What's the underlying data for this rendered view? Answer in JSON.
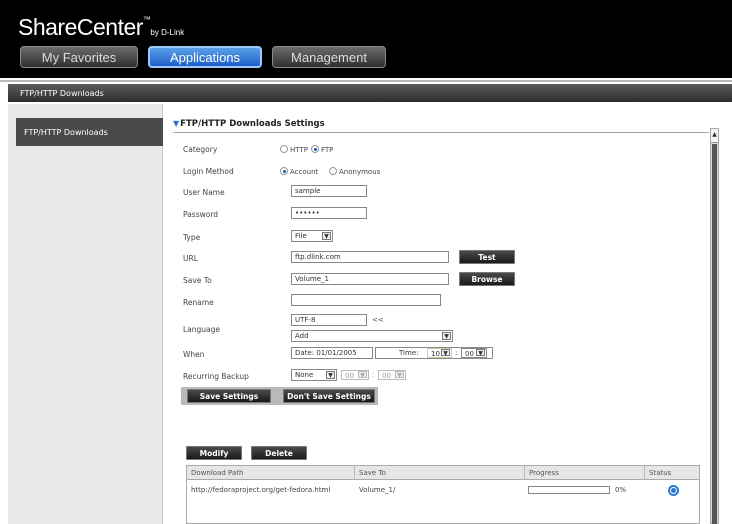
{
  "brand": {
    "name": "ShareCenter",
    "tm": "™",
    "by": "by D-Link"
  },
  "tabs": [
    {
      "label": "My Favorites"
    },
    {
      "label": "Applications"
    },
    {
      "label": "Management"
    }
  ],
  "titlebar": "FTP/HTTP Downloads",
  "sidebar": {
    "items": [
      {
        "label": "FTP/HTTP Downloads"
      }
    ]
  },
  "settings": {
    "title": "FTP/HTTP Downloads Settings",
    "category": {
      "label": "Category",
      "options": [
        "HTTP",
        "FTP"
      ],
      "selected": "FTP"
    },
    "login_method": {
      "label": "Login Method",
      "options": [
        "Account",
        "Anonymous"
      ],
      "selected": "Account"
    },
    "user_name": {
      "label": "User Name",
      "value": "sample"
    },
    "password": {
      "label": "Password",
      "value": "••••••"
    },
    "type": {
      "label": "Type",
      "value": "File"
    },
    "url": {
      "label": "URL",
      "value": "ftp.dlink.com",
      "test_label": "Test"
    },
    "save_to": {
      "label": "Save To",
      "value": "Volume_1",
      "browse_label": "Browse"
    },
    "rename": {
      "label": "Rename",
      "value": ""
    },
    "language": {
      "label": "Language",
      "value": "UTF-8",
      "arrows": "<<",
      "select_value": "Add"
    },
    "when": {
      "label": "When",
      "date_label": "Date:",
      "date_value": "01/01/2005",
      "time_label": "Time:",
      "hour": "10",
      "colon": ":",
      "minute": "00"
    },
    "recurring_backup": {
      "label": "Recurring Backup",
      "value": "None",
      "hour": "00",
      "colon": ":",
      "minute": "00"
    },
    "save_button": "Save Settings",
    "dont_save_button": "Don't Save Settings"
  },
  "actions": {
    "modify": "Modify",
    "delete": "Delete"
  },
  "table": {
    "headers": [
      "Download Path",
      "Save To",
      "Progress",
      "Status"
    ],
    "rows": [
      {
        "path": "http://fedoraproject.org/get-fedora.html",
        "save_to": "Volume_1/",
        "progress": 0,
        "progress_label": "0%"
      }
    ]
  },
  "colors": {
    "accent": "#1d5ec7",
    "header_bg": "#000000",
    "button_dark": "#2a2a2a"
  },
  "icons": {
    "status": "status-icon",
    "section_arrow": "triangle-down-icon",
    "scroll_up": "scroll-up-icon"
  }
}
